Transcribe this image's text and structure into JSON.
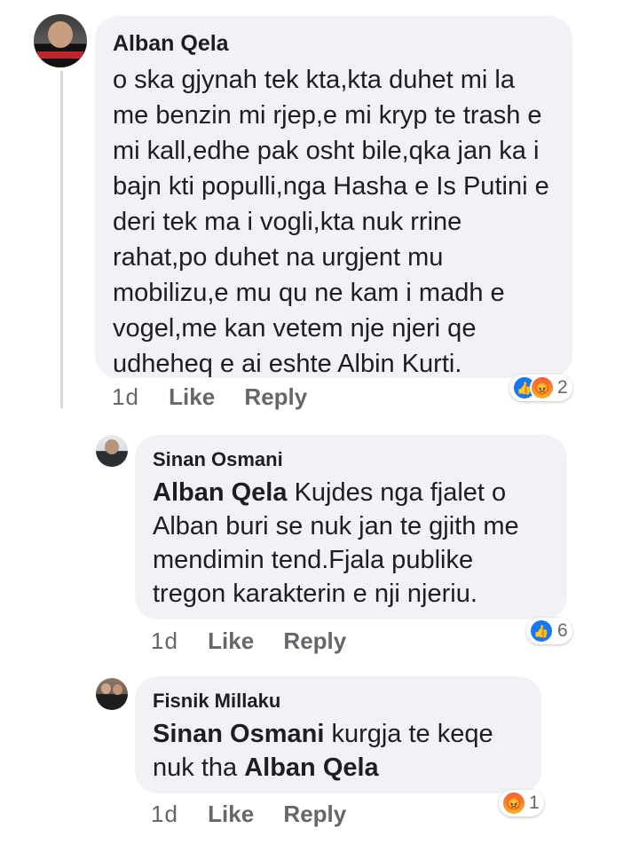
{
  "comments": [
    {
      "author": "Alban Qela",
      "text": "o ska gjynah tek kta,kta duhet mi la me benzin mi rjep,e mi kryp te trash e mi kall,edhe pak osht bile,qka jan ka i bajn kti populli,nga Hasha e Is Putini e deri tek ma i vogli,kta nuk rrine rahat,po duhet na urgjent mu mobilizu,e mu qu ne kam i madh e vogel,me kan vetem nje njeri qe udheheq e ai eshte Albin Kurti.",
      "time": "1d",
      "like_label": "Like",
      "reply_label": "Reply",
      "reactions": {
        "icons": [
          "like-icon",
          "angry-icon"
        ],
        "count": "2"
      }
    },
    {
      "author": "Sinan Osmani",
      "mention": "Alban Qela",
      "text": "Kujdes nga fjalet o Alban buri se nuk jan te gjith me mendimin tend.Fjala publike tregon karakterin e nji njeriu.",
      "time": "1d",
      "like_label": "Like",
      "reply_label": "Reply",
      "reactions": {
        "icons": [
          "like-icon"
        ],
        "count": "6"
      }
    },
    {
      "author": "Fisnik Millaku",
      "mention": "Sinan Osmani",
      "text": "kurgja te keqe nuk tha",
      "mention2": "Alban Qela",
      "time": "1d",
      "like_label": "Like",
      "reply_label": "Reply",
      "reactions": {
        "icons": [
          "angry-icon"
        ],
        "count": "1"
      }
    }
  ],
  "colors": {
    "bubble": "#f0f2f5",
    "meta_text": "#65676b",
    "like_blue": "#1877f2",
    "angry_orange": "#f25e3d"
  }
}
